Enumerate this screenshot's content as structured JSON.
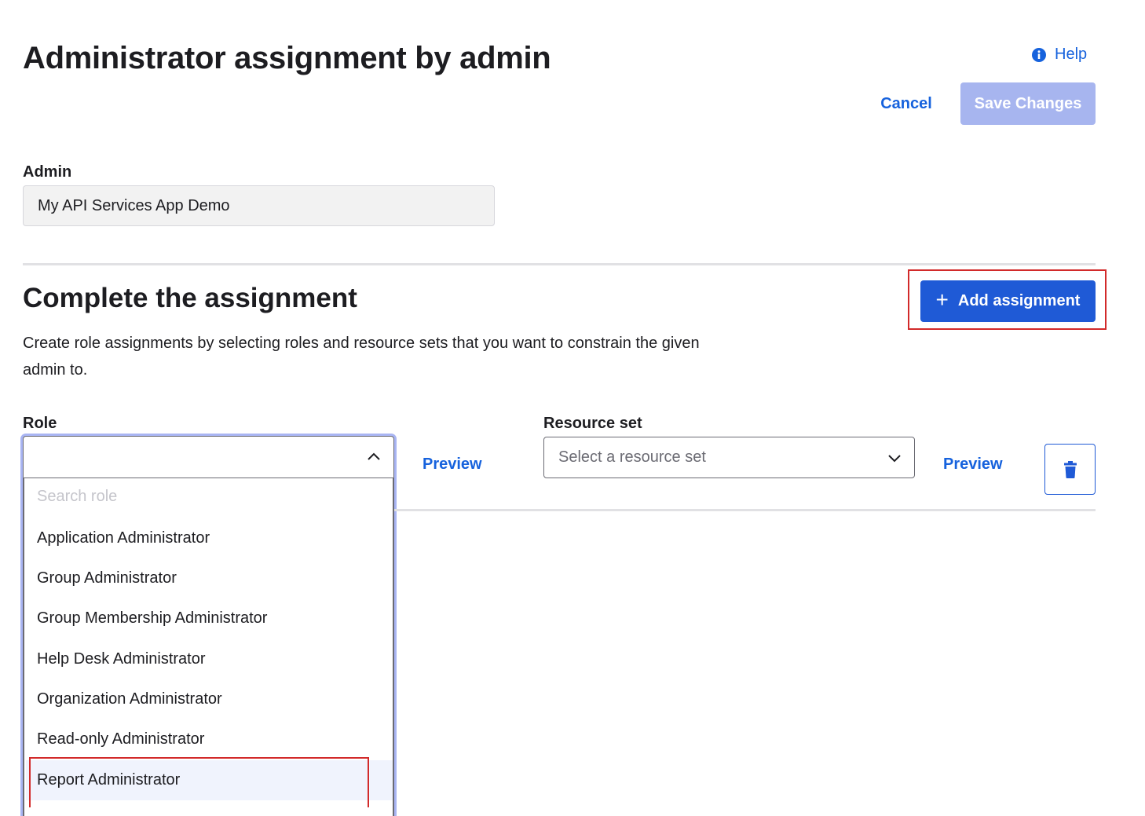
{
  "header": {
    "title": "Administrator assignment by admin",
    "help_label": "Help",
    "cancel_label": "Cancel",
    "save_label": "Save Changes"
  },
  "admin": {
    "label": "Admin",
    "value": "My API Services App Demo"
  },
  "assignment": {
    "title": "Complete the assignment",
    "add_button_label": "Add assignment",
    "description": "Create role assignments by selecting roles and resource sets that you want to constrain the given admin to."
  },
  "role": {
    "label": "Role",
    "value": "",
    "search_placeholder": "Search role",
    "options": [
      "Application Administrator",
      "Group Administrator",
      "Group Membership Administrator",
      "Help Desk Administrator",
      "Organization Administrator",
      "Read-only Administrator",
      "Report Administrator"
    ],
    "highlighted_option": "Report Administrator",
    "preview_label": "Preview"
  },
  "resource_set": {
    "label": "Resource set",
    "placeholder": "Select a resource set",
    "preview_label": "Preview"
  },
  "colors": {
    "primary": "#1f5ad6",
    "link": "#1662dd",
    "disabled_primary": "#a7b5ef",
    "focus_ring": "#a9b5f3",
    "callout_outline": "#d22a2a"
  }
}
